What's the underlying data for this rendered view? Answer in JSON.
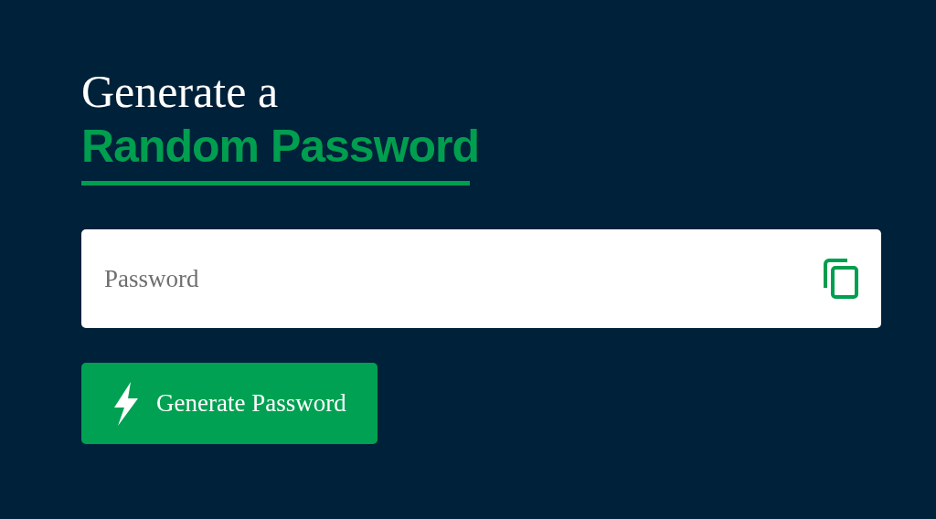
{
  "heading": {
    "line_1": "Generate a",
    "line_2": "Random Password"
  },
  "password_field": {
    "placeholder": "Password"
  },
  "generate_button": {
    "label": "Generate Password"
  }
}
